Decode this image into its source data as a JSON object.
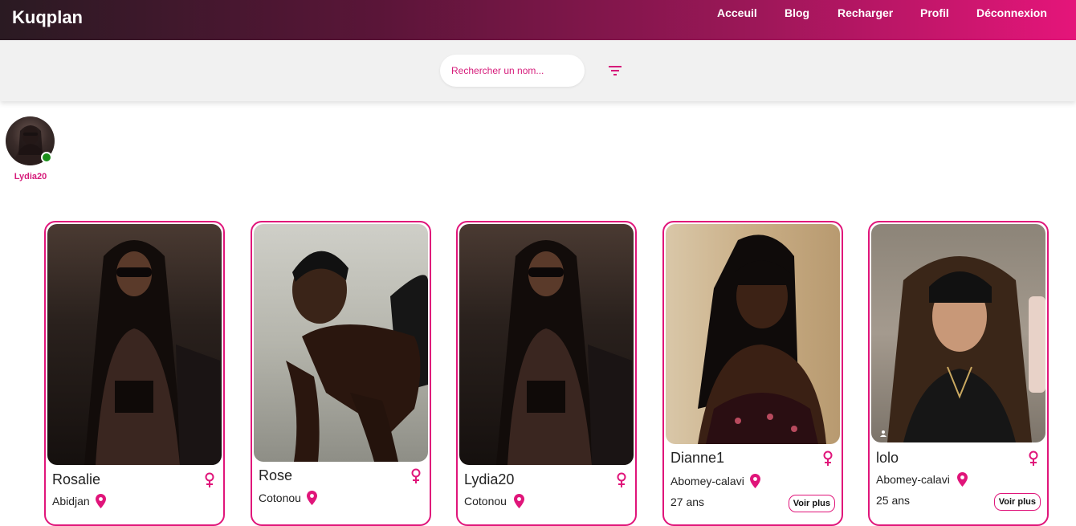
{
  "header": {
    "logo": "Kuqplan",
    "nav": [
      "Acceuil",
      "Blog",
      "Recharger",
      "Profil",
      "Déconnexion"
    ]
  },
  "search": {
    "placeholder": "Rechercher un nom..."
  },
  "stories": [
    {
      "name": "Lydia20",
      "online": true
    }
  ],
  "profiles": [
    {
      "name": "Rosalie",
      "city": "Abidjan"
    },
    {
      "name": "Rose",
      "city": "Cotonou"
    },
    {
      "name": "Lydia20",
      "city": "Cotonou"
    },
    {
      "name": "Dianne1",
      "city": "Abomey-calavi",
      "age": "27 ans",
      "button": "Voir plus"
    },
    {
      "name": "lolo",
      "city": "Abomey-calavi",
      "age": "25 ans",
      "button": "Voir plus"
    }
  ],
  "colors": {
    "accent": "#e0157a",
    "online": "#1a8f1a"
  }
}
